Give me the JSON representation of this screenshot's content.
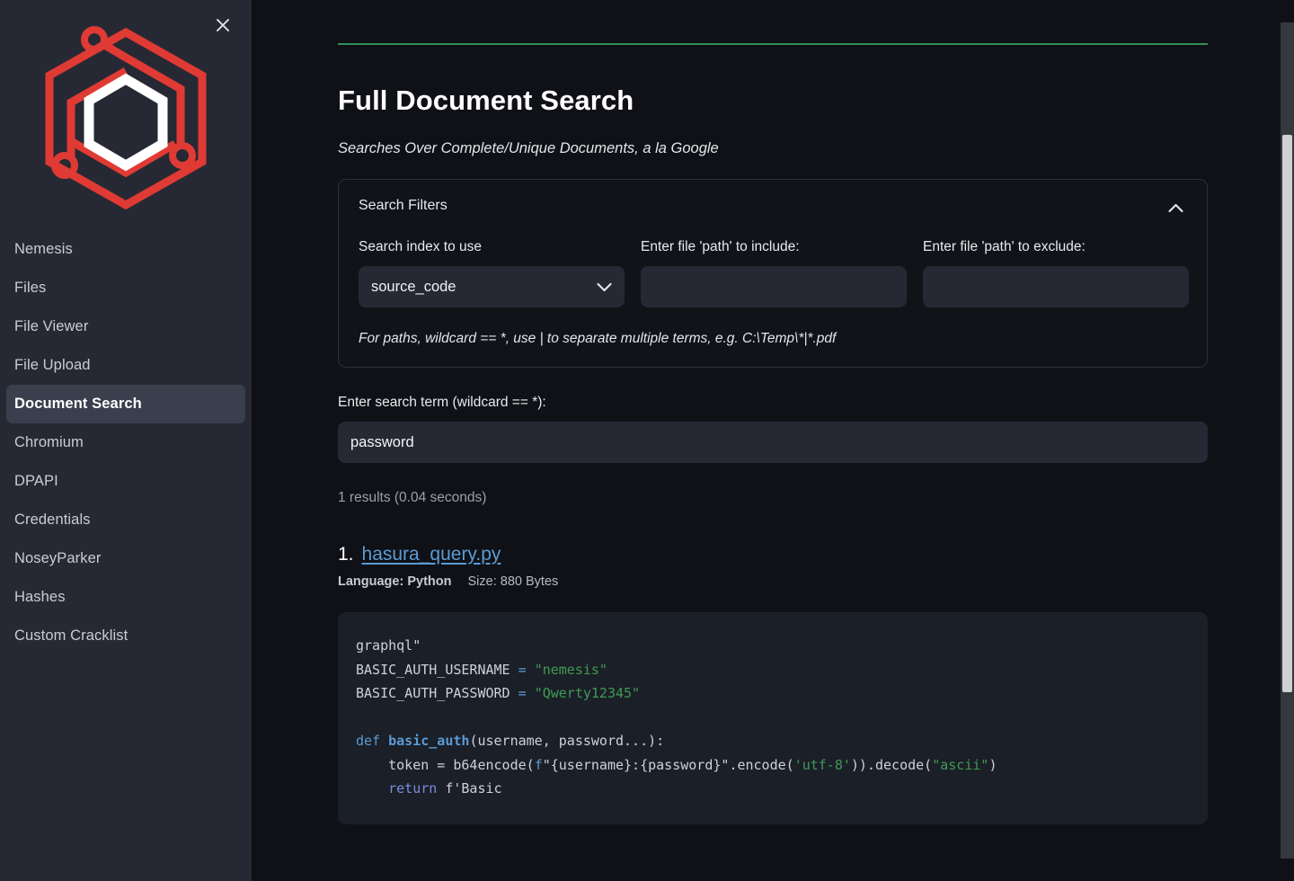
{
  "sidebar": {
    "close_icon": "close-icon",
    "logo_alt": "nemesis-logo",
    "items": [
      {
        "label": "Nemesis",
        "active": false
      },
      {
        "label": "Files",
        "active": false
      },
      {
        "label": "File Viewer",
        "active": false
      },
      {
        "label": "File Upload",
        "active": false
      },
      {
        "label": "Document Search",
        "active": true
      },
      {
        "label": "Chromium",
        "active": false
      },
      {
        "label": "DPAPI",
        "active": false
      },
      {
        "label": "Credentials",
        "active": false
      },
      {
        "label": "NoseyParker",
        "active": false
      },
      {
        "label": "Hashes",
        "active": false
      },
      {
        "label": "Custom Cracklist",
        "active": false
      }
    ]
  },
  "page": {
    "title": "Full Document Search",
    "subtitle": "Searches Over Complete/Unique Documents, a la Google",
    "rule_color": "#2f8f5b"
  },
  "filters": {
    "title": "Search Filters",
    "toggle_icon": "chevron-up-icon",
    "index_label": "Search index to use",
    "index_value": "source_code",
    "index_options": [
      "source_code"
    ],
    "index_chevron_icon": "chevron-down-icon",
    "include_label": "Enter file 'path' to include:",
    "include_value": "",
    "include_placeholder": "",
    "exclude_label": "Enter file 'path' to exclude:",
    "exclude_value": "",
    "exclude_placeholder": "",
    "hint": "For paths, wildcard == *, use | to separate multiple terms, e.g. C:\\Temp\\*|*.pdf"
  },
  "search": {
    "label": "Enter search term (wildcard == *):",
    "value": "password",
    "placeholder": "",
    "result_count": "1 results (0.04 seconds)"
  },
  "result": {
    "index": "1.",
    "filename": "hasura_query.py",
    "language_label": "Language: Python",
    "size_label": "Size: 880 Bytes",
    "code": {
      "line1": "graphql\"",
      "line2_name": "BASIC_AUTH_USERNAME",
      "line2_eq": "=",
      "line2_val": "\"nemesis\"",
      "line3_name": "BASIC_AUTH_PASSWORD",
      "line3_eq": "=",
      "line3_val": "\"Qwerty12345\"",
      "line5_def": "def",
      "line5_fn": "basic_auth",
      "line5_args": "(username, password...):",
      "line6_pre": "    token = b64encode(",
      "line6_f": "f",
      "line6_fstr": "\"{username}:{password}\"",
      "line6_mid": ".encode(",
      "line6_enc": "'utf-8'",
      "line6_mid2": ")).decode(",
      "line6_asc": "\"ascii\"",
      "line6_end": ")",
      "line7_kw": "    return",
      "line7_rest": " f'Basic"
    }
  },
  "scrollbar": {
    "thumb_name": "vertical-scrollbar-thumb"
  },
  "colors": {
    "sidebar_bg": "#262933",
    "main_bg": "#0f1116",
    "accent_green": "#2f8f5b",
    "accent_red": "#e03a34",
    "link_blue": "#5b9bd5",
    "code_bg": "#1b1f27"
  }
}
